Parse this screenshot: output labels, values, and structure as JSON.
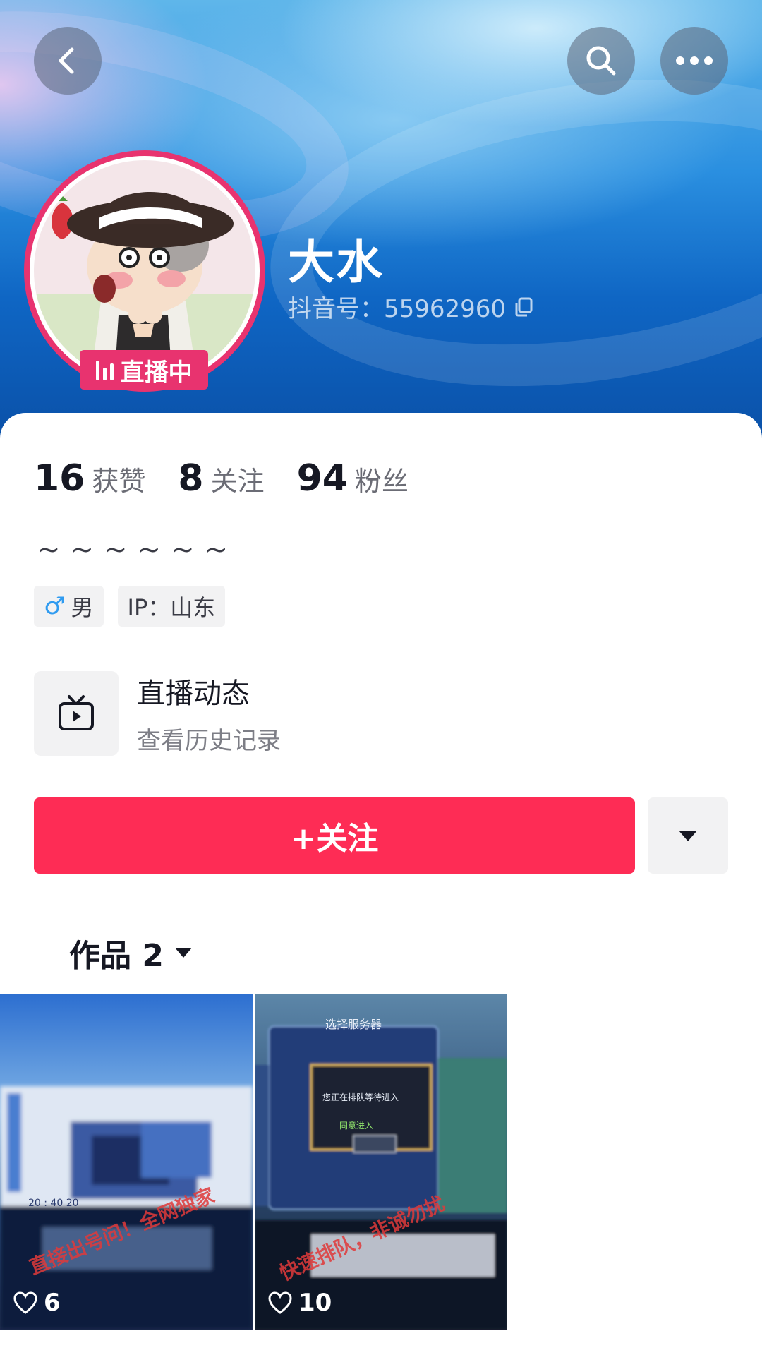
{
  "profile": {
    "nickname": "大水",
    "douyin_id": "抖音号：55962960",
    "live_badge": "直播中"
  },
  "stats": [
    {
      "value": "16",
      "label": "获赞"
    },
    {
      "value": "8",
      "label": "关注"
    },
    {
      "value": "94",
      "label": "粉丝"
    }
  ],
  "bio": "~~~~~~",
  "tags": {
    "gender_label": "男",
    "gender_icon": "male-icon",
    "ip": "IP：山东"
  },
  "live_dynamic": {
    "title": "直播动态",
    "subtitle": "查看历史记录",
    "icon": "tv-icon"
  },
  "actions": {
    "follow_label": "+关注",
    "dropdown_icon": "caret-down-icon"
  },
  "works": {
    "tab_label": "作品 2",
    "items": [
      {
        "likes": "6",
        "overlay_text": "直接出号问！全网独家"
      },
      {
        "likes": "10",
        "overlay_text": "快速排队，非诚勿扰"
      }
    ]
  },
  "colors": {
    "accent": "#fe2c55",
    "live": "#e8336f",
    "banner": "#1a78d6"
  }
}
